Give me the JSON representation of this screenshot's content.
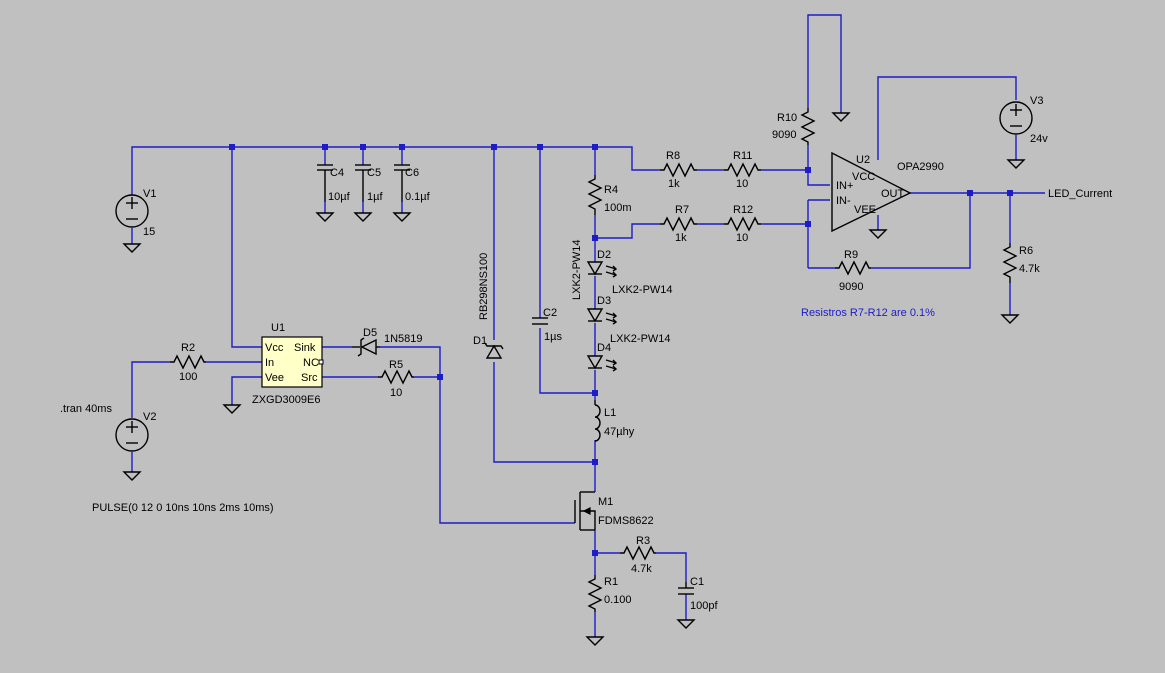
{
  "labels": {
    "v1": "V1",
    "v1_val": "15",
    "v2": "V2",
    "tran": ".tran 40ms",
    "pulse": "PULSE(0 12 0 10ns 10ns 2ms 10ms)",
    "v3": "V3",
    "v3_val": "24v",
    "r2": "R2",
    "r2_val": "100",
    "u1": "U1",
    "u1_part": "ZXGD3009E6",
    "u1_vcc": "Vcc",
    "u1_in": "In",
    "u1_vee": "Vee",
    "u1_sink": "Sink",
    "u1_nc": "NC",
    "u1_src": "Src",
    "d5": "D5",
    "d5_part": "1N5819",
    "r5": "R5",
    "r5_val": "10",
    "c4": "C4",
    "c4_val": "10µf",
    "c5": "C5",
    "c5_val": "1µf",
    "c6": "C6",
    "c6_val": "0.1µf",
    "d1": "D1",
    "d1_part": "RB298NS100",
    "c2": "C2",
    "c2_val": "1µs",
    "r4": "R4",
    "r4_val": "100m",
    "d2": "D2",
    "d2_part": "LXK2-PW14",
    "d3": "D3",
    "d3_part": "LXK2-PW14",
    "d4": "D4",
    "d4_part": "LXK2-PW14",
    "l1": "L1",
    "l1_val": "47µhy",
    "m1": "M1",
    "m1_part": "FDMS8622",
    "r1": "R1",
    "r1_val": "0.100",
    "r3": "R3",
    "r3_val": "4.7k",
    "c1": "C1",
    "c1_val": "100pf",
    "r8": "R8",
    "r8_val": "1k",
    "r11": "R11",
    "r11_val": "10",
    "r7": "R7",
    "r7_val": "1k",
    "r12": "R12",
    "r12_val": "10",
    "r10": "R10",
    "r10_val": "9090",
    "r9": "R9",
    "r9_val": "9090",
    "u2": "U2",
    "u2_part": "OPA2990",
    "u2_vcc": "VCC",
    "u2_vee": "VEE",
    "u2_inp": "IN+",
    "u2_inm": "IN-",
    "u2_out": "OUT",
    "r6": "R6",
    "r6_val": "4.7k",
    "net_led": "LED_Current",
    "note": "Resistros R7-R12 are 0.1%"
  },
  "colors": {
    "background": "#c0c0c0",
    "wire": "#1c1cc8",
    "component": "#000000",
    "ic_fill": "#ffffc8"
  }
}
